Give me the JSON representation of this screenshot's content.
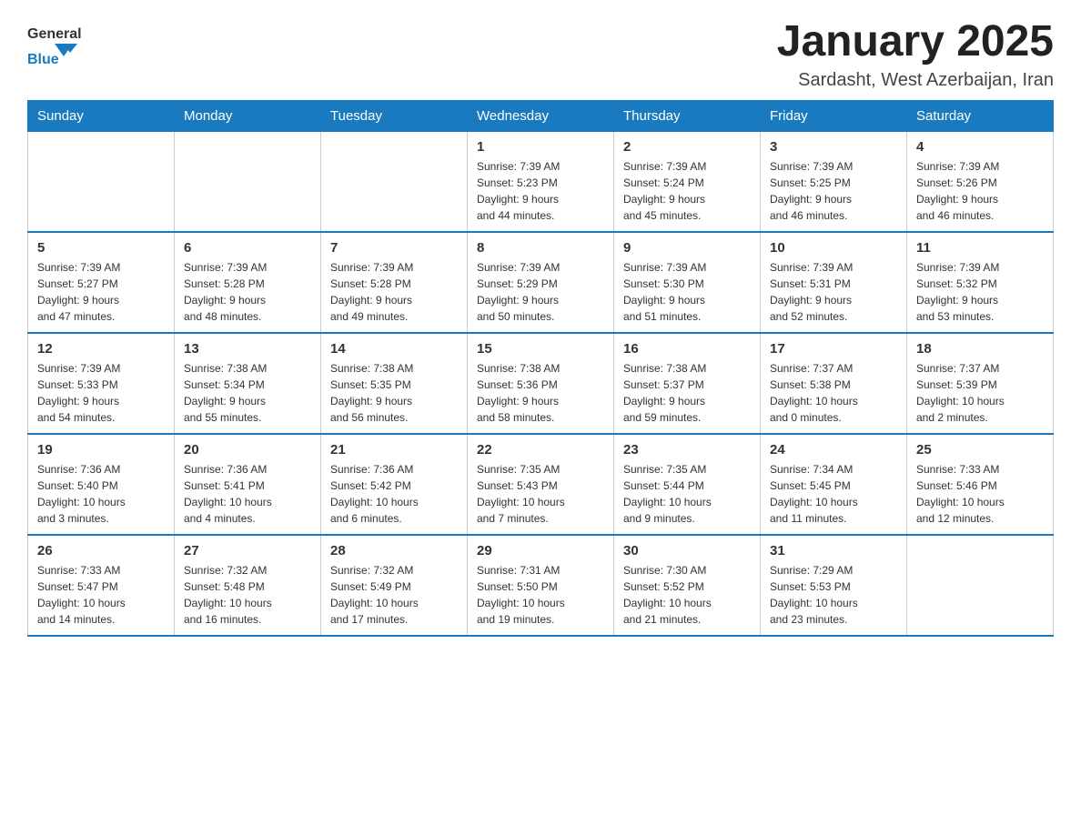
{
  "header": {
    "logo_general": "General",
    "logo_blue": "Blue",
    "month_year": "January 2025",
    "location": "Sardasht, West Azerbaijan, Iran"
  },
  "days_of_week": [
    "Sunday",
    "Monday",
    "Tuesday",
    "Wednesday",
    "Thursday",
    "Friday",
    "Saturday"
  ],
  "weeks": [
    [
      {
        "day": "",
        "info": ""
      },
      {
        "day": "",
        "info": ""
      },
      {
        "day": "",
        "info": ""
      },
      {
        "day": "1",
        "info": "Sunrise: 7:39 AM\nSunset: 5:23 PM\nDaylight: 9 hours\nand 44 minutes."
      },
      {
        "day": "2",
        "info": "Sunrise: 7:39 AM\nSunset: 5:24 PM\nDaylight: 9 hours\nand 45 minutes."
      },
      {
        "day": "3",
        "info": "Sunrise: 7:39 AM\nSunset: 5:25 PM\nDaylight: 9 hours\nand 46 minutes."
      },
      {
        "day": "4",
        "info": "Sunrise: 7:39 AM\nSunset: 5:26 PM\nDaylight: 9 hours\nand 46 minutes."
      }
    ],
    [
      {
        "day": "5",
        "info": "Sunrise: 7:39 AM\nSunset: 5:27 PM\nDaylight: 9 hours\nand 47 minutes."
      },
      {
        "day": "6",
        "info": "Sunrise: 7:39 AM\nSunset: 5:28 PM\nDaylight: 9 hours\nand 48 minutes."
      },
      {
        "day": "7",
        "info": "Sunrise: 7:39 AM\nSunset: 5:28 PM\nDaylight: 9 hours\nand 49 minutes."
      },
      {
        "day": "8",
        "info": "Sunrise: 7:39 AM\nSunset: 5:29 PM\nDaylight: 9 hours\nand 50 minutes."
      },
      {
        "day": "9",
        "info": "Sunrise: 7:39 AM\nSunset: 5:30 PM\nDaylight: 9 hours\nand 51 minutes."
      },
      {
        "day": "10",
        "info": "Sunrise: 7:39 AM\nSunset: 5:31 PM\nDaylight: 9 hours\nand 52 minutes."
      },
      {
        "day": "11",
        "info": "Sunrise: 7:39 AM\nSunset: 5:32 PM\nDaylight: 9 hours\nand 53 minutes."
      }
    ],
    [
      {
        "day": "12",
        "info": "Sunrise: 7:39 AM\nSunset: 5:33 PM\nDaylight: 9 hours\nand 54 minutes."
      },
      {
        "day": "13",
        "info": "Sunrise: 7:38 AM\nSunset: 5:34 PM\nDaylight: 9 hours\nand 55 minutes."
      },
      {
        "day": "14",
        "info": "Sunrise: 7:38 AM\nSunset: 5:35 PM\nDaylight: 9 hours\nand 56 minutes."
      },
      {
        "day": "15",
        "info": "Sunrise: 7:38 AM\nSunset: 5:36 PM\nDaylight: 9 hours\nand 58 minutes."
      },
      {
        "day": "16",
        "info": "Sunrise: 7:38 AM\nSunset: 5:37 PM\nDaylight: 9 hours\nand 59 minutes."
      },
      {
        "day": "17",
        "info": "Sunrise: 7:37 AM\nSunset: 5:38 PM\nDaylight: 10 hours\nand 0 minutes."
      },
      {
        "day": "18",
        "info": "Sunrise: 7:37 AM\nSunset: 5:39 PM\nDaylight: 10 hours\nand 2 minutes."
      }
    ],
    [
      {
        "day": "19",
        "info": "Sunrise: 7:36 AM\nSunset: 5:40 PM\nDaylight: 10 hours\nand 3 minutes."
      },
      {
        "day": "20",
        "info": "Sunrise: 7:36 AM\nSunset: 5:41 PM\nDaylight: 10 hours\nand 4 minutes."
      },
      {
        "day": "21",
        "info": "Sunrise: 7:36 AM\nSunset: 5:42 PM\nDaylight: 10 hours\nand 6 minutes."
      },
      {
        "day": "22",
        "info": "Sunrise: 7:35 AM\nSunset: 5:43 PM\nDaylight: 10 hours\nand 7 minutes."
      },
      {
        "day": "23",
        "info": "Sunrise: 7:35 AM\nSunset: 5:44 PM\nDaylight: 10 hours\nand 9 minutes."
      },
      {
        "day": "24",
        "info": "Sunrise: 7:34 AM\nSunset: 5:45 PM\nDaylight: 10 hours\nand 11 minutes."
      },
      {
        "day": "25",
        "info": "Sunrise: 7:33 AM\nSunset: 5:46 PM\nDaylight: 10 hours\nand 12 minutes."
      }
    ],
    [
      {
        "day": "26",
        "info": "Sunrise: 7:33 AM\nSunset: 5:47 PM\nDaylight: 10 hours\nand 14 minutes."
      },
      {
        "day": "27",
        "info": "Sunrise: 7:32 AM\nSunset: 5:48 PM\nDaylight: 10 hours\nand 16 minutes."
      },
      {
        "day": "28",
        "info": "Sunrise: 7:32 AM\nSunset: 5:49 PM\nDaylight: 10 hours\nand 17 minutes."
      },
      {
        "day": "29",
        "info": "Sunrise: 7:31 AM\nSunset: 5:50 PM\nDaylight: 10 hours\nand 19 minutes."
      },
      {
        "day": "30",
        "info": "Sunrise: 7:30 AM\nSunset: 5:52 PM\nDaylight: 10 hours\nand 21 minutes."
      },
      {
        "day": "31",
        "info": "Sunrise: 7:29 AM\nSunset: 5:53 PM\nDaylight: 10 hours\nand 23 minutes."
      },
      {
        "day": "",
        "info": ""
      }
    ]
  ]
}
